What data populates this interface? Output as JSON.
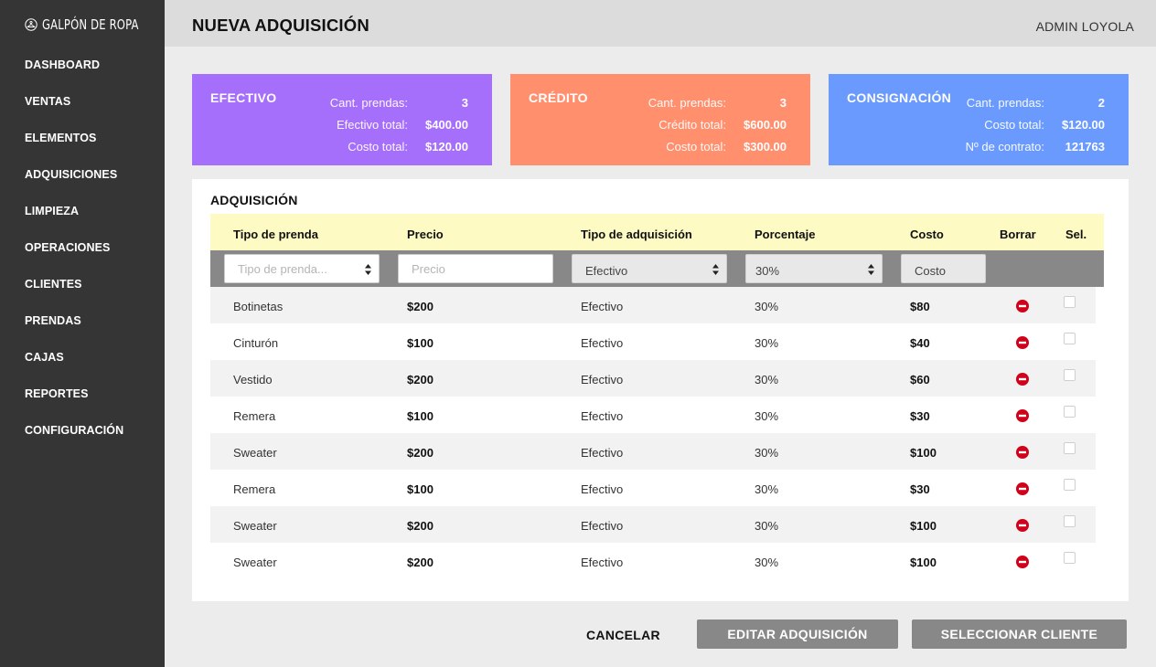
{
  "brand": {
    "name": "GALPÓN DE ROPA",
    "icon": "hanger-icon"
  },
  "sidebar": {
    "items": [
      {
        "label": "DASHBOARD"
      },
      {
        "label": "VENTAS"
      },
      {
        "label": "ELEMENTOS"
      },
      {
        "label": "ADQUISICIONES"
      },
      {
        "label": "LIMPIEZA"
      },
      {
        "label": "OPERACIONES"
      },
      {
        "label": "CLIENTES"
      },
      {
        "label": "PRENDAS"
      },
      {
        "label": "CAJAS"
      },
      {
        "label": "REPORTES"
      },
      {
        "label": "CONFIGURACIÓN"
      }
    ]
  },
  "header": {
    "title": "NUEVA ADQUISICIÓN",
    "user": "ADMIN LOYOLA"
  },
  "cards": [
    {
      "title": "EFECTIVO",
      "color": "#a66ffb",
      "rows": [
        {
          "label": "Cant. prendas:",
          "value": "3"
        },
        {
          "label": "Efectivo total:",
          "value": "$400.00"
        },
        {
          "label": "Costo total:",
          "value": "$120.00"
        }
      ]
    },
    {
      "title": "CRÉDITO",
      "color": "#ff8f6d",
      "rows": [
        {
          "label": "Cant. prendas:",
          "value": "3"
        },
        {
          "label": "Crédito total:",
          "value": "$600.00"
        },
        {
          "label": "Costo total:",
          "value": "$300.00"
        }
      ]
    },
    {
      "title": "CONSIGNACIÓN",
      "color": "#6a9afe",
      "rows": [
        {
          "label": "Cant. prendas:",
          "value": "2"
        },
        {
          "label": "Costo total:",
          "value": "$120.00"
        },
        {
          "label": "Nº de contrato:",
          "value": "121763"
        }
      ]
    }
  ],
  "panel": {
    "title": "ADQUISICIÓN",
    "columns": [
      "Tipo de prenda",
      "Precio",
      "Tipo de adquisición",
      "Porcentaje",
      "Costo",
      "Borrar",
      "Sel."
    ],
    "filters": {
      "tipo_placeholder": "Tipo de prenda...",
      "precio_placeholder": "Precio",
      "adquisicion_value": "Efectivo",
      "porcentaje_value": "30%",
      "costo_value": "Costo"
    },
    "rows": [
      {
        "tipo": "Botinetas",
        "precio": "$200",
        "adquisicion": "Efectivo",
        "porcentaje": "30%",
        "costo": "$80"
      },
      {
        "tipo": "Cinturón",
        "precio": "$100",
        "adquisicion": "Efectivo",
        "porcentaje": "30%",
        "costo": "$40"
      },
      {
        "tipo": "Vestido",
        "precio": "$200",
        "adquisicion": "Efectivo",
        "porcentaje": "30%",
        "costo": "$60"
      },
      {
        "tipo": "Remera",
        "precio": "$100",
        "adquisicion": "Efectivo",
        "porcentaje": "30%",
        "costo": "$30"
      },
      {
        "tipo": "Sweater",
        "precio": "$200",
        "adquisicion": "Efectivo",
        "porcentaje": "30%",
        "costo": "$100"
      },
      {
        "tipo": "Remera",
        "precio": "$100",
        "adquisicion": "Efectivo",
        "porcentaje": "30%",
        "costo": "$30"
      },
      {
        "tipo": "Sweater",
        "precio": "$200",
        "adquisicion": "Efectivo",
        "porcentaje": "30%",
        "costo": "$100"
      },
      {
        "tipo": "Sweater",
        "precio": "$200",
        "adquisicion": "Efectivo",
        "porcentaje": "30%",
        "costo": "$100"
      }
    ]
  },
  "footer": {
    "cancel_label": "CANCELAR",
    "edit_label": "EDITAR ADQUISICIÓN",
    "client_label": "SELECCIONAR CLIENTE"
  },
  "colors": {
    "sidebar": "#353535",
    "header": "#dcdcdc",
    "delete": "#d0021b",
    "table_header": "#fdfac4",
    "filter_bar": "#888888"
  }
}
